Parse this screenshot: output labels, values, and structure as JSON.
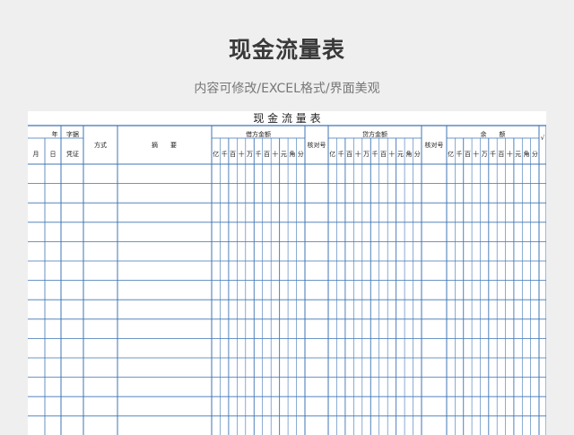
{
  "page": {
    "title": "现金流量表",
    "subtitle": "内容可修改/EXCEL格式/界面美观"
  },
  "ledger": {
    "title": "现 金 流 量 表",
    "headers": {
      "year": "年",
      "voucher_word": "字据",
      "method": "方式",
      "summary": "摘　　要",
      "debit_amount": "借方金额",
      "check_no_1": "核对号",
      "credit_amount": "贷方金额",
      "check_no_2": "核对号",
      "balance": "余　　额",
      "tick": "√",
      "month": "月",
      "day": "日",
      "voucher": "凭证"
    },
    "digit_units": [
      "亿",
      "千",
      "百",
      "十",
      "万",
      "千",
      "百",
      "十",
      "元",
      "角",
      "分"
    ],
    "blank_rows": 13,
    "grid_color": "#3f74b4"
  }
}
